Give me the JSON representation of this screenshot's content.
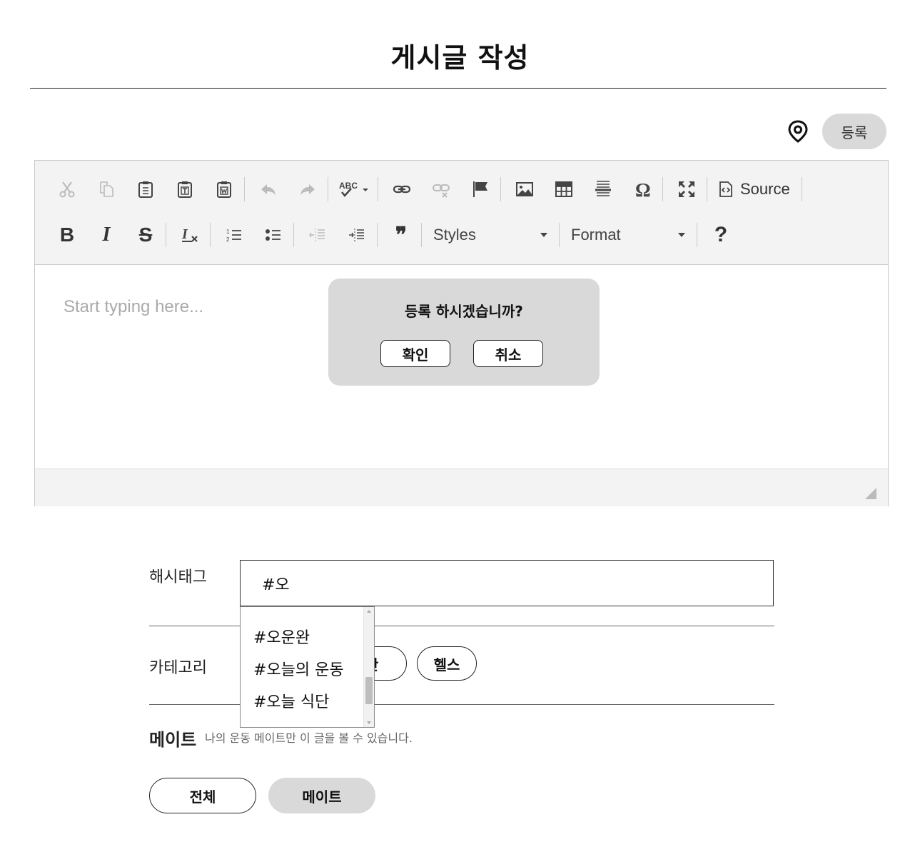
{
  "header": {
    "title": "게시글 작성",
    "register_label": "등록"
  },
  "editor": {
    "placeholder": "Start typing here...",
    "toolbar": {
      "source_label": "Source",
      "styles_label": "Styles",
      "format_label": "Format",
      "help_label": "?",
      "bold_label": "B",
      "italic_label": "I",
      "strike_label": "S",
      "blockquote_label": "❞",
      "spell_label": "ABC"
    }
  },
  "dialog": {
    "message": "등록 하시겠습니까?",
    "confirm_label": "확인",
    "cancel_label": "취소"
  },
  "form": {
    "hashtag_label": "해시태그",
    "hashtag_value": "#오",
    "hashtag_suggestions": [
      "#오운완",
      "#오늘의 운동",
      "#오늘 식단"
    ],
    "category_label": "카테고리",
    "categories": [
      "등산",
      "헬스"
    ],
    "mate_label": "메이트",
    "mate_note": "나의 운동 메이트만 이 글을 볼 수 있습니다.",
    "visibility_options": [
      "전체",
      "메이트"
    ]
  }
}
